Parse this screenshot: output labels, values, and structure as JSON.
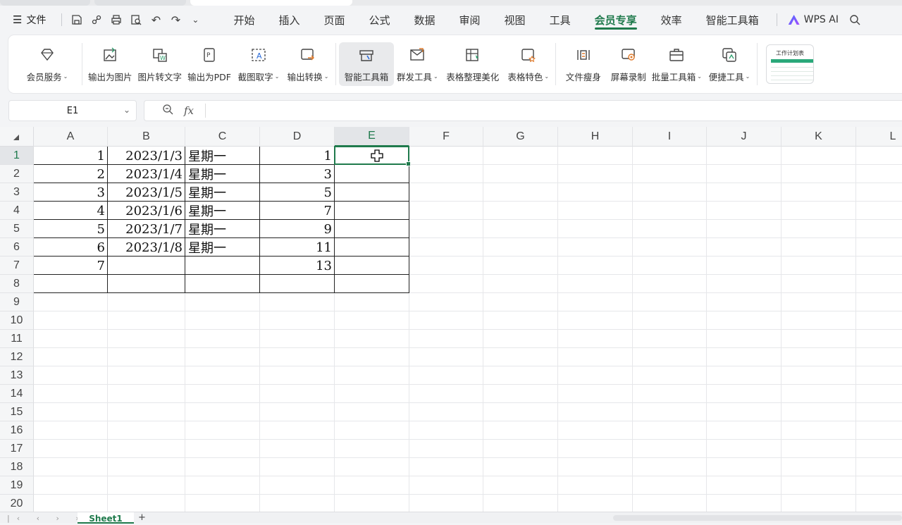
{
  "menubar": {
    "file_label": "文件",
    "tabs": [
      "开始",
      "插入",
      "页面",
      "公式",
      "数据",
      "审阅",
      "视图",
      "工具",
      "会员专享",
      "效率",
      "智能工具箱"
    ],
    "active_tab": "会员专享",
    "wps_ai": "WPS AI"
  },
  "ribbon": {
    "buttons": [
      {
        "label": "会员服务",
        "dropdown": true,
        "icon": "diamond-icon"
      },
      {
        "label": "输出为图片",
        "dropdown": false,
        "icon": "export-image-icon"
      },
      {
        "label": "图片转文字",
        "dropdown": false,
        "icon": "image-to-text-icon"
      },
      {
        "label": "输出为PDF",
        "dropdown": false,
        "icon": "export-pdf-icon"
      },
      {
        "label": "截图取字",
        "dropdown": true,
        "icon": "screenshot-ocr-icon"
      },
      {
        "label": "输出转换",
        "dropdown": true,
        "icon": "convert-icon"
      },
      {
        "label": "智能工具箱",
        "dropdown": false,
        "icon": "toolbox-icon",
        "selected": true
      },
      {
        "label": "群发工具",
        "dropdown": true,
        "icon": "mass-send-icon"
      },
      {
        "label": "表格整理美化",
        "dropdown": false,
        "icon": "table-beautify-icon"
      },
      {
        "label": "表格特色",
        "dropdown": true,
        "icon": "table-feature-icon"
      },
      {
        "label": "文件瘦身",
        "dropdown": false,
        "icon": "file-slim-icon"
      },
      {
        "label": "屏幕录制",
        "dropdown": false,
        "icon": "screen-record-icon"
      },
      {
        "label": "批量工具箱",
        "dropdown": true,
        "icon": "batch-toolbox-icon"
      },
      {
        "label": "便捷工具",
        "dropdown": true,
        "icon": "handy-tools-icon"
      }
    ],
    "template_thumb_title": "工作计划表"
  },
  "formula_bar": {
    "cell_ref": "E1",
    "fx": "fx",
    "formula": ""
  },
  "sheet": {
    "columns": [
      "A",
      "B",
      "C",
      "D",
      "E",
      "F",
      "G",
      "H",
      "I",
      "J",
      "K",
      "L"
    ],
    "selected_column": "E",
    "rows": [
      "1",
      "2",
      "3",
      "4",
      "5",
      "6",
      "7",
      "8",
      "9",
      "10",
      "11",
      "12",
      "13",
      "14",
      "15",
      "16",
      "17",
      "18",
      "19",
      "20"
    ],
    "selected_row": "1",
    "data": [
      {
        "A": "1",
        "B": "2023/1/3",
        "C": "星期一",
        "D": "1",
        "E": ""
      },
      {
        "A": "2",
        "B": "2023/1/4",
        "C": "星期一",
        "D": "3",
        "E": ""
      },
      {
        "A": "3",
        "B": "2023/1/5",
        "C": "星期一",
        "D": "5",
        "E": ""
      },
      {
        "A": "4",
        "B": "2023/1/6",
        "C": "星期一",
        "D": "7",
        "E": ""
      },
      {
        "A": "5",
        "B": "2023/1/7",
        "C": "星期一",
        "D": "9",
        "E": ""
      },
      {
        "A": "6",
        "B": "2023/1/8",
        "C": "星期一",
        "D": "11",
        "E": ""
      },
      {
        "A": "7",
        "B": "",
        "C": "",
        "D": "13",
        "E": ""
      },
      {
        "A": "",
        "B": "",
        "C": "",
        "D": "",
        "E": ""
      }
    ]
  },
  "bottom": {
    "sheet_tab": "Sheet1",
    "add_sheet": "+"
  }
}
